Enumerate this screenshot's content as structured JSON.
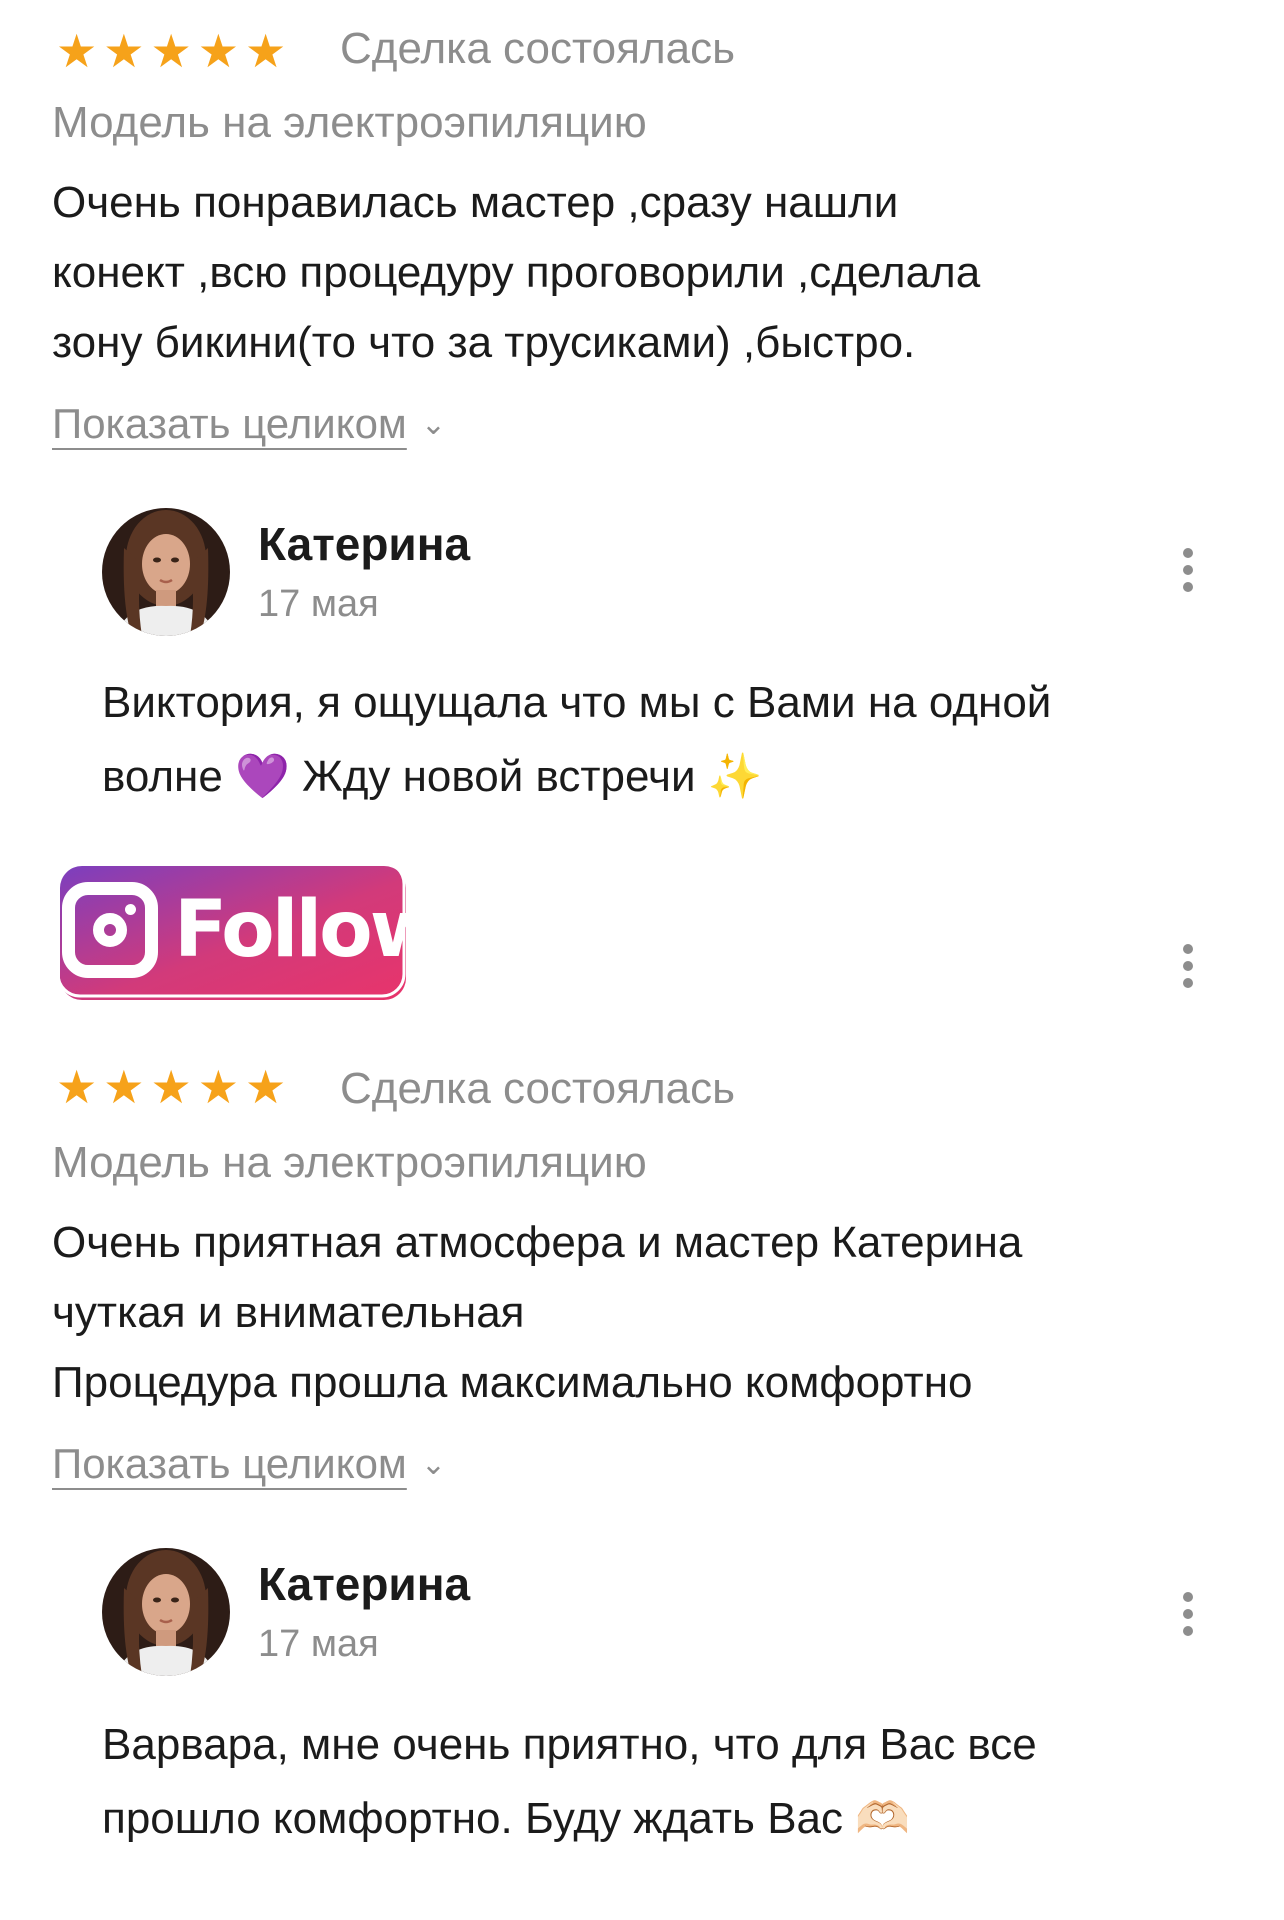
{
  "colors": {
    "star": "#f6a21a",
    "muted": "#8d8d8d",
    "text": "#1b1b1b",
    "follow_gradient_start": "#8a3ab9",
    "follow_gradient_end": "#e1306c"
  },
  "reviews": [
    {
      "rating": 5,
      "status": "Сделка состоялась",
      "service": "Модель на электроэпиляцию",
      "text_lines": [
        "Очень понравилась мастер ,сразу нашли",
        "конект ,всю процедуру проговорили ,сделала",
        "зону бикини(то что за трусиками) ,быстро."
      ],
      "show_more_label": "Показать целиком",
      "reply": {
        "author": "Катерина",
        "date": "17 мая",
        "text_lines": [
          "Виктория, я ощущала что мы с Вами на одной",
          "волне 💜 Жду новой встречи ✨"
        ]
      }
    },
    {
      "rating": 5,
      "status": "Сделка состоялась",
      "service": "Модель на электроэпиляцию",
      "text_lines": [
        "Очень приятная атмосфера и мастер Катерина",
        "чуткая и внимательная",
        "Процедура прошла максимально комфортно"
      ],
      "show_more_label": "Показать целиком",
      "reply": {
        "author": "Катерина",
        "date": "17 мая",
        "text_lines": [
          "Варвара, мне очень приятно, что для Вас все",
          "прошло комфортно. Буду ждать Вас 🫶🏻"
        ]
      }
    }
  ],
  "follow_badge": {
    "label": "Follow",
    "icon": "instagram-icon"
  }
}
